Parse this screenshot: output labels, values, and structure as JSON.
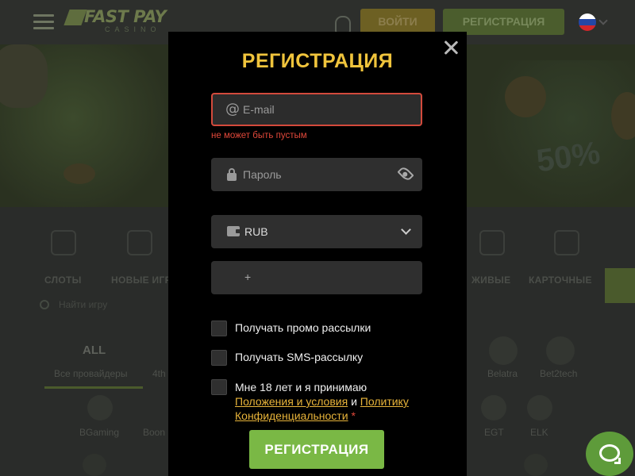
{
  "header": {
    "logo_top": "FAST PAY",
    "logo_bottom": "CASINO",
    "login_label": "ВОЙТИ",
    "register_label": "РЕГИСТРАЦИЯ",
    "flag_colors": [
      "#ffffff",
      "#2447a6",
      "#d3262b"
    ]
  },
  "banner": {
    "percent": "50%"
  },
  "categories": {
    "items": [
      "СЛОТЫ",
      "НОВЫЕ ИГРЫ",
      "ЖИВЫЕ",
      "КАРТОЧНЫЕ"
    ],
    "search_placeholder": "Найти игру"
  },
  "providers": {
    "all_tab": "ALL",
    "labels": [
      "Все провайдеры",
      "4th",
      "Belatra",
      "Bet2tech"
    ],
    "names": [
      "BGaming",
      "Boon",
      "EGT",
      "ELK"
    ]
  },
  "modal": {
    "title": "РЕГИСТРАЦИЯ",
    "email_placeholder": "E-mail",
    "email_error": "не может быть пустым",
    "password_placeholder": "Пароль",
    "currency_value": "RUB",
    "phone_prefix": "+",
    "promo_label": "Получать промо рассылки",
    "sms_label": "Получать SMS-рассылку",
    "terms_prefix": "Мне 18 лет и я принимаю",
    "terms_link": "Положения и условия",
    "terms_and": "и",
    "privacy_link": "Политику Конфиденциальности",
    "required_mark": "*",
    "submit_label": "РЕГИСТРАЦИЯ"
  },
  "colors": {
    "title_gold": "#f0c43c",
    "error_red": "#e0483a",
    "submit_green": "#7ab845",
    "link_gold": "#e8b43a",
    "chat_green": "#5e9b3a"
  }
}
